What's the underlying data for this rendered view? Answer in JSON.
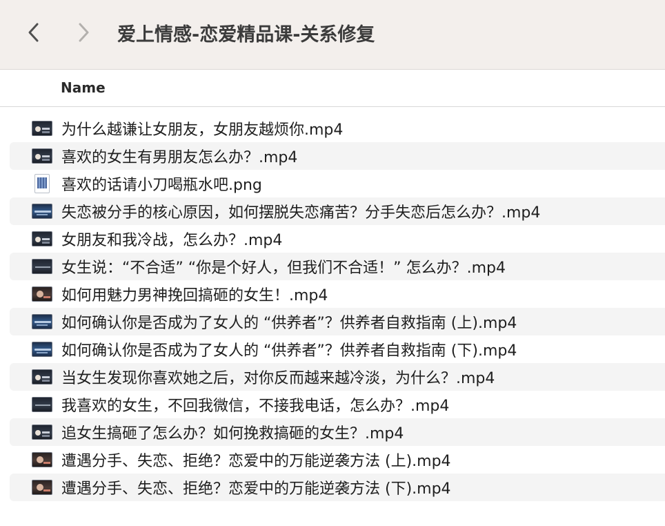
{
  "window": {
    "title": "爱上情感-恋爱精品课-关系修复"
  },
  "toolbar": {
    "back_icon": "chevron-left-icon",
    "forward_icon": "chevron-right-icon"
  },
  "list": {
    "column_header": "Name",
    "files": [
      {
        "name": "为什么越谦让女朋友，女朋友越烦你.mp4",
        "icon": "video-thumbnail-icon"
      },
      {
        "name": "喜欢的女生有男朋友怎么办？.mp4",
        "icon": "video-thumbnail-icon"
      },
      {
        "name": "喜欢的话请小刀喝瓶水吧.png",
        "icon": "image-file-icon"
      },
      {
        "name": "失恋被分手的核心原因，如何摆脱失恋痛苦？分手失恋后怎么办？.mp4",
        "icon": "video-thumbnail-icon"
      },
      {
        "name": "女朋友和我冷战，怎么办？.mp4",
        "icon": "video-thumbnail-icon"
      },
      {
        "name": "女生说：“不合适” “你是个好人，但我们不合适！” 怎么办？.mp4",
        "icon": "video-thumbnail-icon"
      },
      {
        "name": "如何用魅力男神挽回搞砸的女生！.mp4",
        "icon": "video-thumbnail-icon"
      },
      {
        "name": "如何确认你是否成为了女人的 “供养者”？供养者自救指南 (上).mp4",
        "icon": "video-thumbnail-icon"
      },
      {
        "name": "如何确认你是否成为了女人的 “供养者”？供养者自救指南 (下).mp4",
        "icon": "video-thumbnail-icon"
      },
      {
        "name": "当女生发现你喜欢她之后，对你反而越来越冷淡，为什么？.mp4",
        "icon": "video-thumbnail-icon"
      },
      {
        "name": "我喜欢的女生，不回我微信，不接我电话，怎么办？.mp4",
        "icon": "video-thumbnail-icon"
      },
      {
        "name": "追女生搞砸了怎么办？如何挽救搞砸的女生？.mp4",
        "icon": "video-thumbnail-icon"
      },
      {
        "name": "遭遇分手、失恋、拒绝？恋爱中的万能逆袭方法 (上).mp4",
        "icon": "video-thumbnail-icon"
      },
      {
        "name": "遭遇分手、失恋、拒绝？恋爱中的万能逆袭方法 (下).mp4",
        "icon": "video-thumbnail-icon"
      }
    ]
  }
}
